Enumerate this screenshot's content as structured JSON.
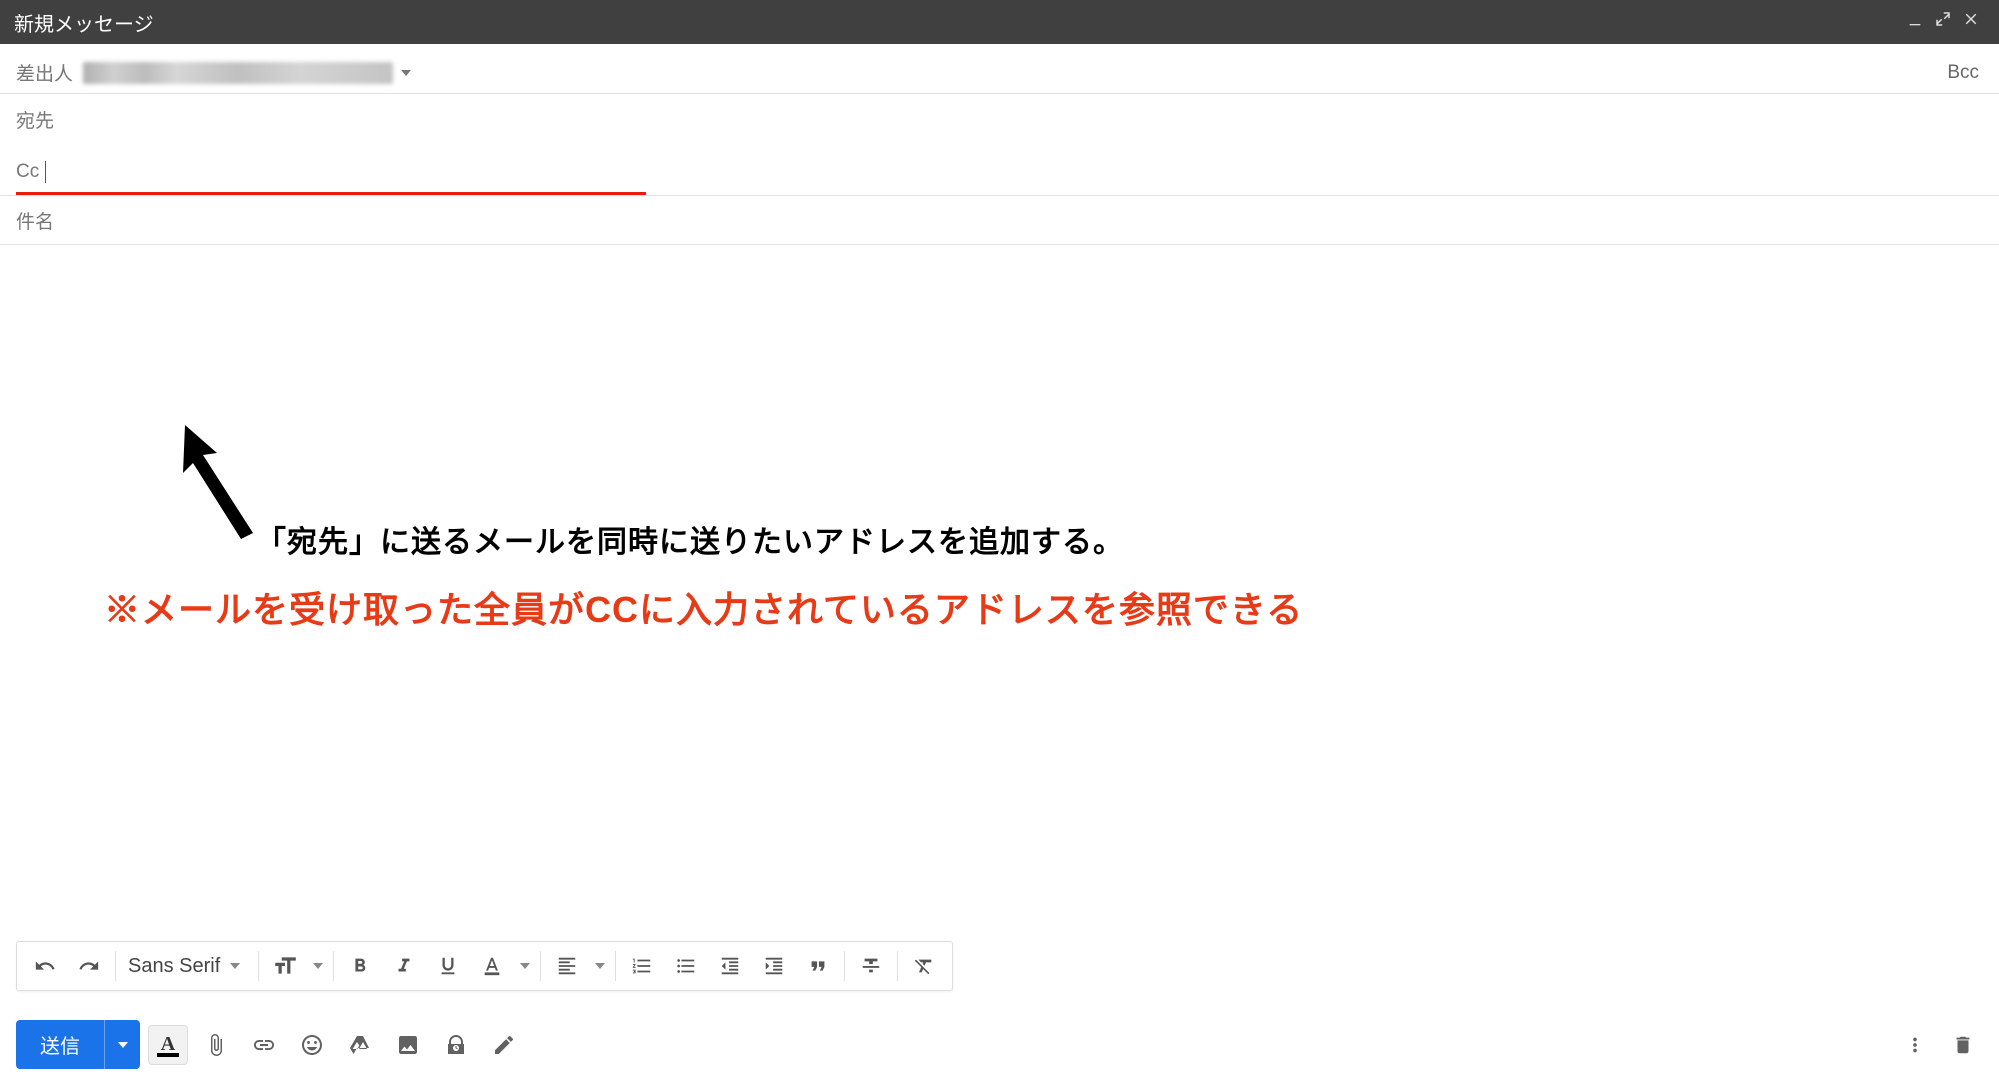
{
  "titlebar": {
    "title": "新規メッセージ"
  },
  "fields": {
    "from_label": "差出人",
    "to_label": "宛先",
    "cc_label": "Cc",
    "bcc_label": "Bcc",
    "subject_label": "件名"
  },
  "annotations": {
    "line1": "「宛先」に送るメールを同時に送りたいアドレスを追加する。",
    "line2": "※メールを受け取った全員がCCに入力されているアドレスを参照できる"
  },
  "format_toolbar": {
    "font_label": "Sans Serif"
  },
  "actions": {
    "send_label": "送信"
  }
}
